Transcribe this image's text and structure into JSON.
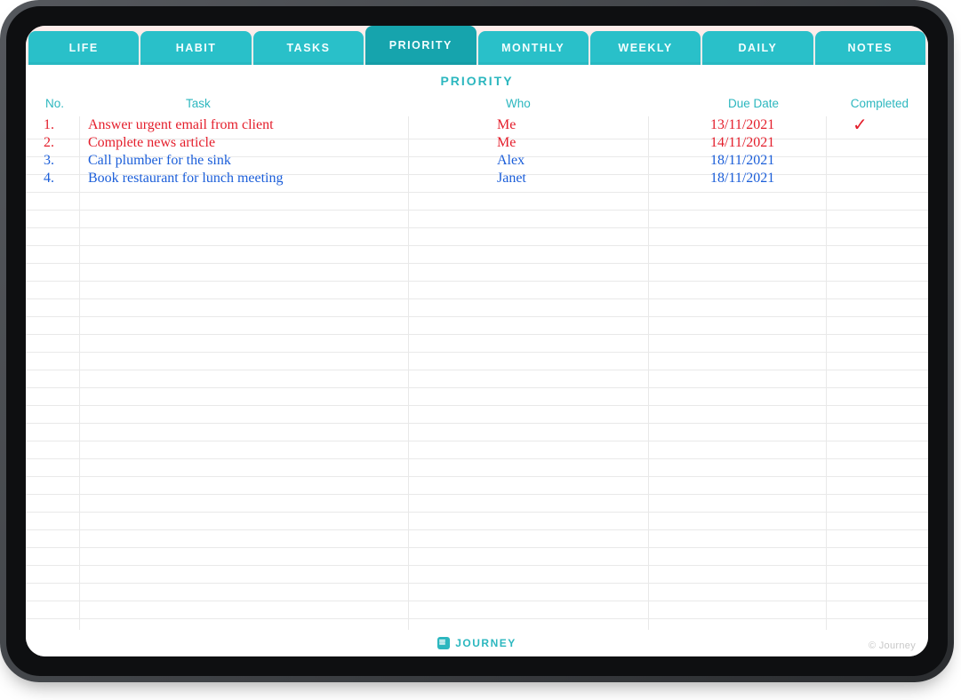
{
  "tabs": [
    {
      "label": "LIFE",
      "active": false
    },
    {
      "label": "HABIT",
      "active": false
    },
    {
      "label": "TASKS",
      "active": false
    },
    {
      "label": "PRIORITY",
      "active": true
    },
    {
      "label": "MONTHLY",
      "active": false
    },
    {
      "label": "WEEKLY",
      "active": false
    },
    {
      "label": "DAILY",
      "active": false
    },
    {
      "label": "NOTES",
      "active": false
    }
  ],
  "page_title": "PRIORITY",
  "columns": {
    "no": "No.",
    "task": "Task",
    "who": "Who",
    "due": "Due Date",
    "completed": "Completed"
  },
  "rows": [
    {
      "no": "1.",
      "task": "Answer urgent email from client",
      "who": "Me",
      "due": "13/11/2021",
      "completed": "✓",
      "ink": "red"
    },
    {
      "no": "2.",
      "task": "Complete news article",
      "who": "Me",
      "due": "14/11/2021",
      "completed": "",
      "ink": "red"
    },
    {
      "no": "3.",
      "task": "Call plumber for the sink",
      "who": "Alex",
      "due": "18/11/2021",
      "completed": "",
      "ink": "blue"
    },
    {
      "no": "4.",
      "task": "Book restaurant for lunch meeting",
      "who": "Janet",
      "due": "18/11/2021",
      "completed": "",
      "ink": "blue"
    }
  ],
  "footer": {
    "brand": "JOURNEY",
    "copyright": "© Journey"
  },
  "colors": {
    "teal": "#29c0c9",
    "teal_dark": "#16a4ad",
    "red_ink": "#e41e2b",
    "blue_ink": "#1b5ed9"
  }
}
